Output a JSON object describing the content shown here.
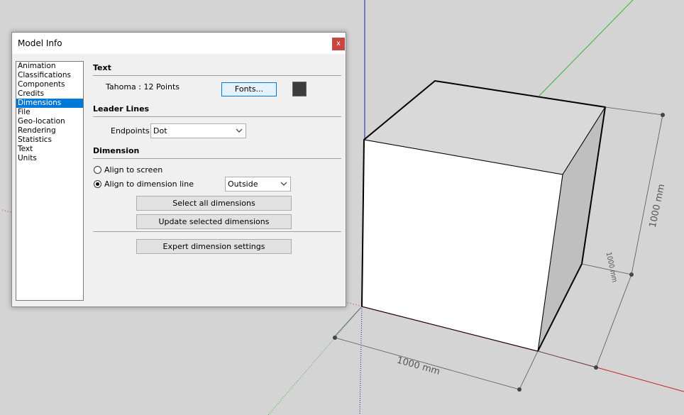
{
  "dialog": {
    "title": "Model Info",
    "close_glyph": "x",
    "categories": [
      "Animation",
      "Classifications",
      "Components",
      "Credits",
      "Dimensions",
      "File",
      "Geo-location",
      "Rendering",
      "Statistics",
      "Text",
      "Units"
    ],
    "selected_category": "Dimensions"
  },
  "text_section": {
    "title": "Text",
    "font_info": "Tahoma : 12 Points",
    "fonts_button": "Fonts...",
    "color": "#3c3c3c"
  },
  "leader_lines": {
    "title": "Leader Lines",
    "endpoints_label": "Endpoints:",
    "endpoints_value": "Dot"
  },
  "dimension_section": {
    "title": "Dimension",
    "align_screen": "Align to screen",
    "align_line": "Align to dimension line",
    "align_selected": "line",
    "position_value": "Outside",
    "select_all_button": "Select all dimensions",
    "update_selected_button": "Update selected dimensions",
    "expert_button": "Expert dimension settings"
  },
  "viewport": {
    "dim_front_label": "1000 mm",
    "dim_side_label": "1000 mm",
    "dim_height_label": "1000 mm",
    "colors": {
      "background": "#d4d4d4",
      "face_front": "#ffffff",
      "face_top": "#d9d9d9",
      "face_right": "#bfbfbf",
      "axis_red": "#c81e1e",
      "axis_green": "#2db52d",
      "axis_blue": "#1a1ab0"
    }
  }
}
